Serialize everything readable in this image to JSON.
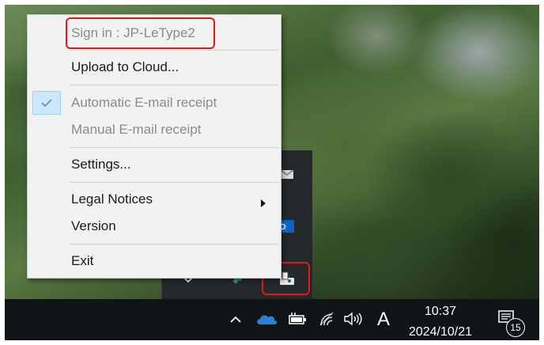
{
  "menu": {
    "signin_label": "Sign in : JP-LeType2",
    "upload_label": "Upload to Cloud...",
    "auto_email_label": "Automatic E-mail receipt",
    "auto_email_checked": true,
    "manual_email_label": "Manual E-mail receipt",
    "settings_label": "Settings...",
    "legal_label": "Legal Notices",
    "version_label": "Version",
    "exit_label": "Exit"
  },
  "taskbar": {
    "time": "10:37",
    "date": "2024/10/21",
    "ime_mode": "A",
    "notification_count": "15"
  },
  "icons": {
    "check": "checkmark-icon",
    "submenu": "chevron-right-icon",
    "tray_up": "chevron-up-icon",
    "onedrive": "cloud-icon",
    "power": "battery-plug-icon",
    "wifi": "wifi-icon",
    "volume": "speaker-icon",
    "notifications": "notification-icon",
    "app_tray": "letype-scanner-icon"
  },
  "colors": {
    "highlight_border": "#e01818",
    "menu_background": "#f2f2f2",
    "taskbar": "#101416",
    "onedrive": "#2a7fd6"
  }
}
